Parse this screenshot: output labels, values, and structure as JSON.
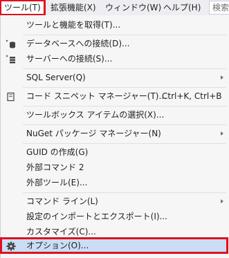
{
  "menubar": {
    "items": [
      {
        "label": "ツール(T)"
      },
      {
        "label": "拡張機能(X)"
      },
      {
        "label": "ウィンドウ(W)"
      },
      {
        "label": "ヘルプ(H)"
      }
    ],
    "search_label": "検索"
  },
  "menu": {
    "get_tools": "ツールと機能を取得(T)...",
    "connect_db": "データベースへの接続(D)...",
    "connect_server": "サーバーへの接続(S)...",
    "sql_server": "SQL Server(Q)",
    "snippet_manager": "コード スニペット マネージャー(T)...",
    "snippet_shortcut": "Ctrl+K, Ctrl+B",
    "toolbox_items": "ツールボックス アイテムの選択(X)...",
    "nuget_manager": "NuGet パッケージ マネージャー(N)",
    "create_guid": "GUID の作成(G)",
    "external_command2": "外部コマンド 2",
    "external_tools": "外部ツール(E)...",
    "command_line": "コマンド ライン(L)",
    "import_export": "設定のインポートとエクスポート(I)...",
    "customize": "カスタマイズ(C)...",
    "options": "オプション(O)..."
  },
  "colors": {
    "highlight_outline": "#e0101e",
    "hover_background": "#c9def5",
    "menu_background": "#f6f6f6"
  }
}
